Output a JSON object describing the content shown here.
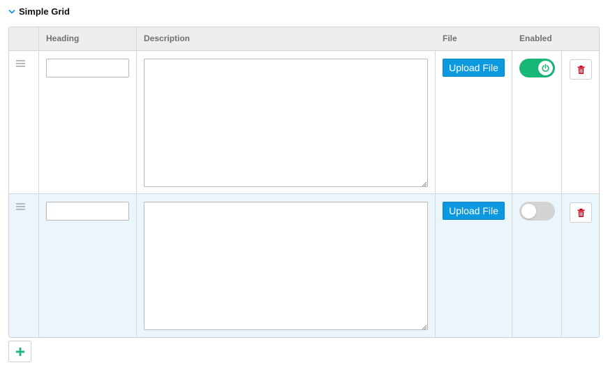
{
  "section": {
    "title": "Simple Grid",
    "collapse_icon": "chevron-down-icon"
  },
  "grid": {
    "columns": [
      "Heading",
      "Description",
      "File",
      "Enabled"
    ],
    "rows": [
      {
        "heading_value": "",
        "description_value": "",
        "upload_label": "Upload File",
        "enabled": true
      },
      {
        "heading_value": "",
        "description_value": "",
        "upload_label": "Upload File",
        "enabled": false
      }
    ]
  },
  "icons": {
    "drag": "drag-handle-icon",
    "delete": "trash-icon",
    "power": "power-icon",
    "add": "plus-icon"
  },
  "colors": {
    "accent_blue": "#0d99e0",
    "toggle_on": "#17b877",
    "toggle_off": "#d3d3d3",
    "delete_red": "#d0021b",
    "add_green": "#17b877",
    "alt_row_bg": "#eaf5fc",
    "header_bg": "#eeeeee"
  }
}
